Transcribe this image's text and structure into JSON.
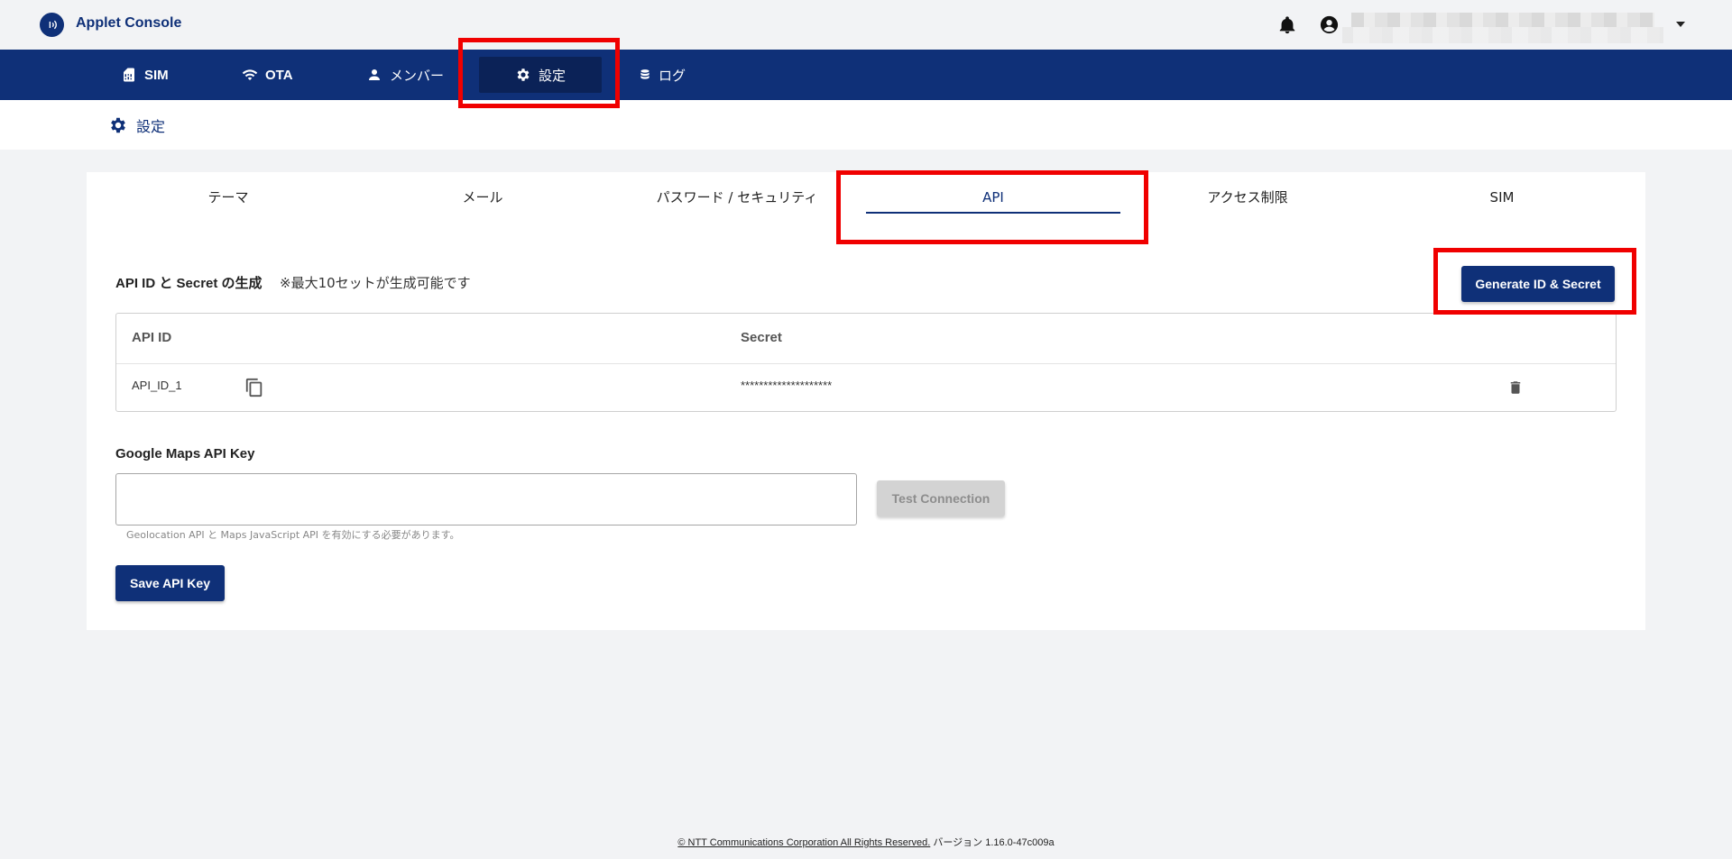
{
  "app": {
    "title": "Applet Console"
  },
  "nav": {
    "items": [
      {
        "label": "SIM",
        "icon": "sim-card-icon"
      },
      {
        "label": "OTA",
        "icon": "wifi-icon"
      },
      {
        "label": "メンバー",
        "icon": "person-icon"
      },
      {
        "label": "設定",
        "icon": "gear-icon",
        "active": true
      },
      {
        "label": "ログ",
        "icon": "database-icon"
      }
    ]
  },
  "breadcrumb": {
    "label": "設定",
    "icon": "gear-icon"
  },
  "tabs": [
    {
      "label": "テーマ"
    },
    {
      "label": "メール"
    },
    {
      "label": "パスワード / セキュリティ"
    },
    {
      "label": "API",
      "active": true
    },
    {
      "label": "アクセス制限"
    },
    {
      "label": "SIM"
    }
  ],
  "api_section": {
    "title": "API ID と Secret の生成",
    "note": "※最大10セットが生成可能です",
    "generate_label": "Generate ID & Secret",
    "table": {
      "headers": {
        "api_id": "API ID",
        "secret": "Secret"
      },
      "rows": [
        {
          "api_id": "API_ID_1",
          "secret": "********************"
        }
      ]
    }
  },
  "google_maps": {
    "label": "Google Maps API Key",
    "value": "",
    "test_label": "Test Connection",
    "help": "Geolocation API と Maps JavaScript API を有効にする必要があります。",
    "save_label": "Save API Key"
  },
  "footer": {
    "copyright": "© NTT Communications Corporation All Rights Reserved.",
    "version": "バージョン 1.16.0-47c009a"
  },
  "colors": {
    "brand": "#0f3078",
    "highlight": "#f00000",
    "background": "#f2f3f5"
  }
}
